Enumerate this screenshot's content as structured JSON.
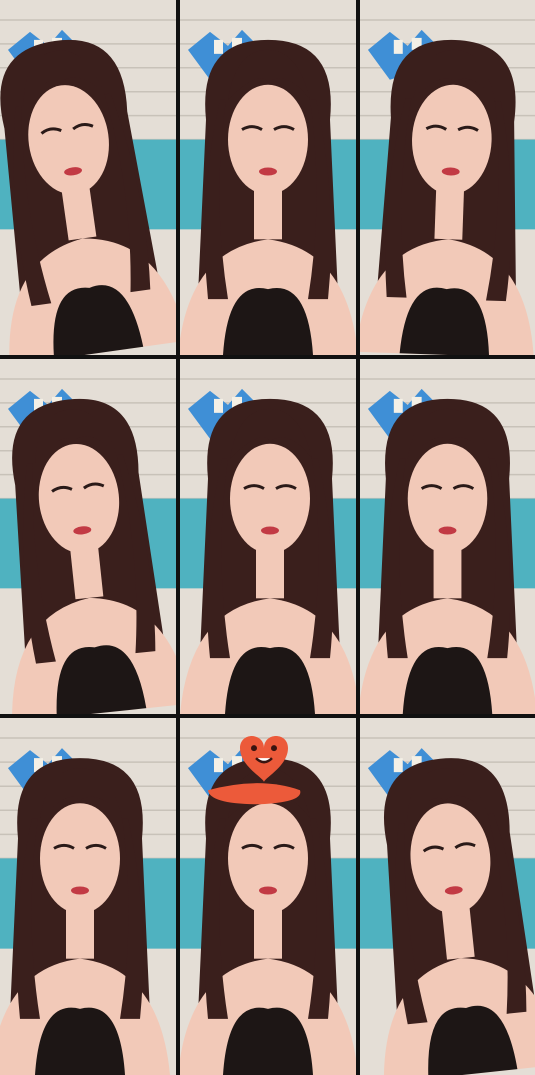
{
  "grid": {
    "rows": 3,
    "columns": 3
  },
  "frames": [
    {
      "id": 1,
      "pose": "looking-left"
    },
    {
      "id": 2,
      "pose": "facing-front"
    },
    {
      "id": 3,
      "pose": "eyes-closed-talking"
    },
    {
      "id": 4,
      "pose": "eyes-closed-tilted"
    },
    {
      "id": 5,
      "pose": "eyes-closed-down"
    },
    {
      "id": 6,
      "pose": "facing-front"
    },
    {
      "id": 7,
      "pose": "facing-front-close"
    },
    {
      "id": 8,
      "pose": "heart-sticker",
      "sticker": "heart-mascot-sticker"
    },
    {
      "id": 9,
      "pose": "smiling-tilted"
    }
  ],
  "colors": {
    "wall": "#e4ded6",
    "brick_line": "#c8c2b9",
    "blue_board": "#3f8fd6",
    "teal_curtain": "#4fb2c0",
    "hair": "#3a1f1c",
    "skin": "#f2c9b8",
    "top": "#1d1615",
    "heart": "#ec5a3a"
  }
}
